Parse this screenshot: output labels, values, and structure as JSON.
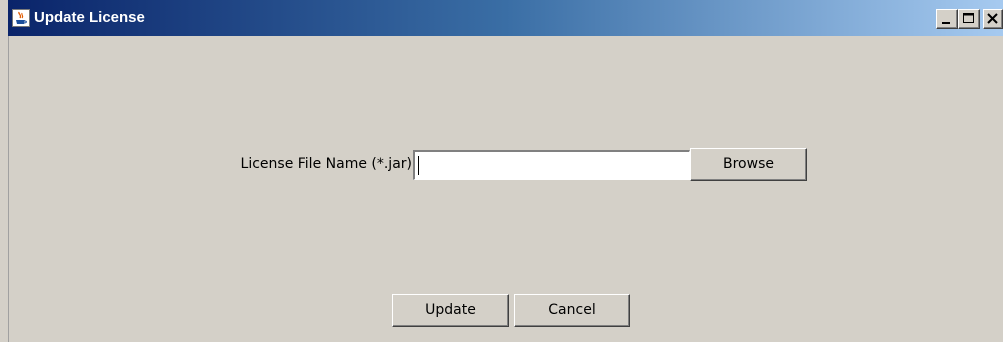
{
  "window": {
    "title": "Update License",
    "icon": "java-cup-icon",
    "controls": {
      "minimize_icon": "minimize-icon",
      "maximize_icon": "maximize-icon",
      "close_icon": "close-icon"
    }
  },
  "form": {
    "file_label": "License File Name (*.jar)",
    "file_value": "",
    "browse_label": "Browse"
  },
  "actions": {
    "update_label": "Update",
    "cancel_label": "Cancel"
  },
  "colors": {
    "titlebar_start": "#0a246a",
    "titlebar_end": "#a6caf0",
    "window_bg": "#d4d0c8"
  }
}
